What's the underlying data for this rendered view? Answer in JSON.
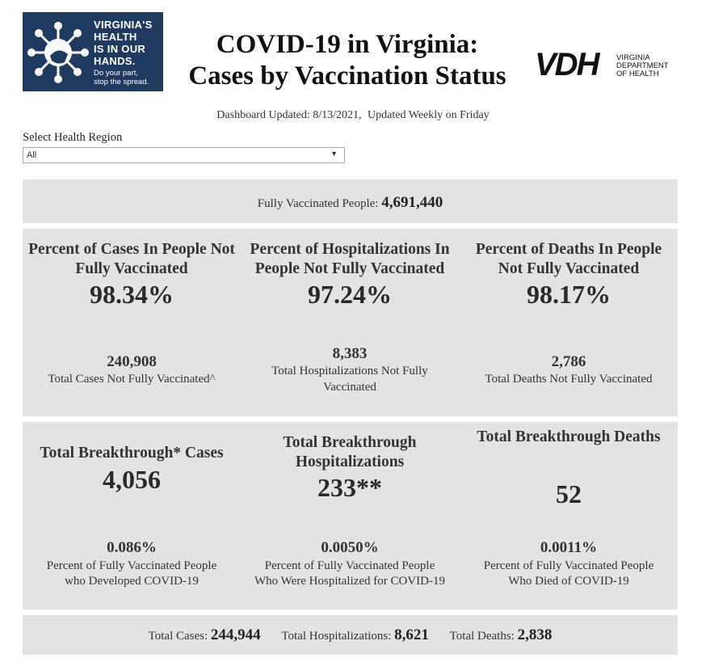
{
  "logo": {
    "headline": "VIRGINIA'S\nHEALTH\nIS IN OUR\nHANDS.",
    "tagline": "Do your part,\nstop the spread.",
    "bg_color": "#1f3a5f"
  },
  "header": {
    "title_line1": "COVID-19 in Virginia:",
    "title_line2": "Cases by Vaccination Status"
  },
  "vdh_logo": {
    "mark": "VDH",
    "text": "VIRGINIA\nDEPARTMENT\nOF HEALTH"
  },
  "updated": {
    "dashboard": "Dashboard Updated: 8/13/2021,",
    "frequency": "Updated Weekly on Friday"
  },
  "region": {
    "label": "Select Health Region",
    "value": "All"
  },
  "fully_vaccinated": {
    "label": "Fully Vaccinated People:",
    "value": "4,691,440"
  },
  "not_vaccinated": [
    {
      "heading_line1": "Percent of Cases In People Not",
      "heading_line2": "Fully Vaccinated",
      "percent": "98.34%",
      "count": "240,908",
      "desc_line1": "Total Cases Not Fully Vaccinated^",
      "desc_line2": ""
    },
    {
      "heading_line1": "Percent of Hospitalizations In",
      "heading_line2": "People Not Fully Vaccinated",
      "percent": "97.24%",
      "count": "8,383",
      "desc_line1": "Total Hospitalizations Not Fully",
      "desc_line2": "Vaccinated"
    },
    {
      "heading_line1": "Percent of Deaths In People",
      "heading_line2": "Not Fully Vaccinated",
      "percent": "98.17%",
      "count": "2,786",
      "desc_line1": "Total Deaths Not Fully Vaccinated",
      "desc_line2": ""
    }
  ],
  "breakthrough": [
    {
      "heading_line1": "Total Breakthrough* Cases",
      "heading_line2": "",
      "value": "4,056",
      "percent": "0.086%",
      "desc_line1": "Percent of Fully Vaccinated People",
      "desc_line2": "who Developed COVID-19"
    },
    {
      "heading_line1": "Total Breakthrough",
      "heading_line2": "Hospitalizations",
      "value": "233**",
      "percent": "0.0050%",
      "desc_line1": "Percent of Fully Vaccinated People",
      "desc_line2": "Who Were Hospitalized for COVID-19"
    },
    {
      "heading_line1": "Total Breakthrough Deaths",
      "heading_line2": "",
      "value": "52",
      "percent": "0.0011%",
      "desc_line1": "Percent of Fully Vaccinated People",
      "desc_line2": "Who Died of COVID-19"
    }
  ],
  "totals": {
    "cases_label": "Total Cases:",
    "cases_value": "244,944",
    "hosp_label": "Total Hospitalizations:",
    "hosp_value": "8,621",
    "deaths_label": "Total Deaths:",
    "deaths_value": "2,838"
  }
}
